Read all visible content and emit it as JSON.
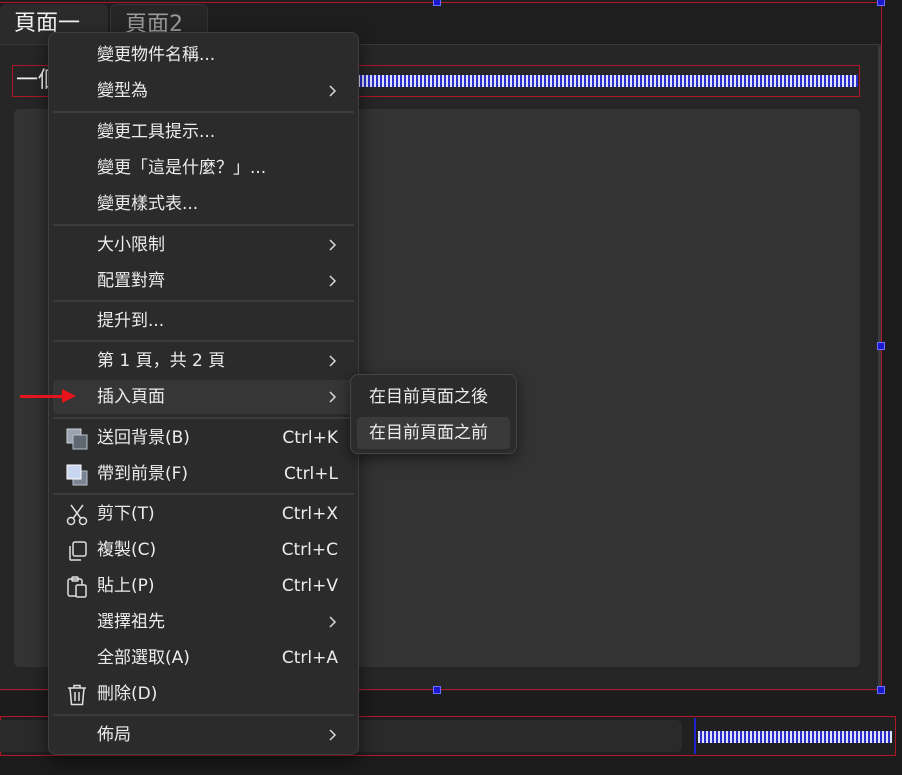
{
  "tabs": [
    {
      "label": "頁面一",
      "active": true
    },
    {
      "label": "頁面2",
      "active": false
    }
  ],
  "canvas": {
    "title_text": "一個",
    "selection_color": "#b0182a",
    "handle_color": "#1a1acc"
  },
  "context_menu": {
    "items": [
      {
        "label": "變更物件名稱...",
        "shortcut": "",
        "submenu": false,
        "icon": ""
      },
      {
        "label": "變型為",
        "shortcut": "",
        "submenu": true,
        "icon": ""
      },
      {
        "label": "變更工具提示...",
        "shortcut": "",
        "submenu": false,
        "icon": ""
      },
      {
        "label": "變更「這是什麼？」...",
        "shortcut": "",
        "submenu": false,
        "icon": ""
      },
      {
        "label": "變更樣式表...",
        "shortcut": "",
        "submenu": false,
        "icon": ""
      },
      {
        "label": "大小限制",
        "shortcut": "",
        "submenu": true,
        "icon": ""
      },
      {
        "label": "配置對齊",
        "shortcut": "",
        "submenu": true,
        "icon": ""
      },
      {
        "label": "提升到...",
        "shortcut": "",
        "submenu": false,
        "icon": ""
      },
      {
        "label": "第 1 頁，共 2 頁",
        "shortcut": "",
        "submenu": true,
        "icon": ""
      },
      {
        "label": "插入頁面",
        "shortcut": "",
        "submenu": true,
        "icon": "",
        "highlighted": true
      },
      {
        "label": "送回背景(B)",
        "shortcut": "Ctrl+K",
        "submenu": false,
        "icon": "send-to-back-icon"
      },
      {
        "label": "帶到前景(F)",
        "shortcut": "Ctrl+L",
        "submenu": false,
        "icon": "bring-to-front-icon"
      },
      {
        "label": "剪下(T)",
        "shortcut": "Ctrl+X",
        "submenu": false,
        "icon": "scissors-icon"
      },
      {
        "label": "複製(C)",
        "shortcut": "Ctrl+C",
        "submenu": false,
        "icon": "copy-icon"
      },
      {
        "label": "貼上(P)",
        "shortcut": "Ctrl+V",
        "submenu": false,
        "icon": "clipboard-icon"
      },
      {
        "label": "選擇祖先",
        "shortcut": "",
        "submenu": true,
        "icon": ""
      },
      {
        "label": "全部選取(A)",
        "shortcut": "Ctrl+A",
        "submenu": false,
        "icon": ""
      },
      {
        "label": "刪除(D)",
        "shortcut": "",
        "submenu": false,
        "icon": "trash-icon"
      },
      {
        "label": "佈局",
        "shortcut": "",
        "submenu": true,
        "icon": ""
      }
    ]
  },
  "submenu": {
    "items": [
      {
        "label": "在目前頁面之後",
        "highlighted": false
      },
      {
        "label": "在目前頁面之前",
        "highlighted": true
      }
    ]
  },
  "annotation": {
    "arrow_color": "#e8141c"
  }
}
